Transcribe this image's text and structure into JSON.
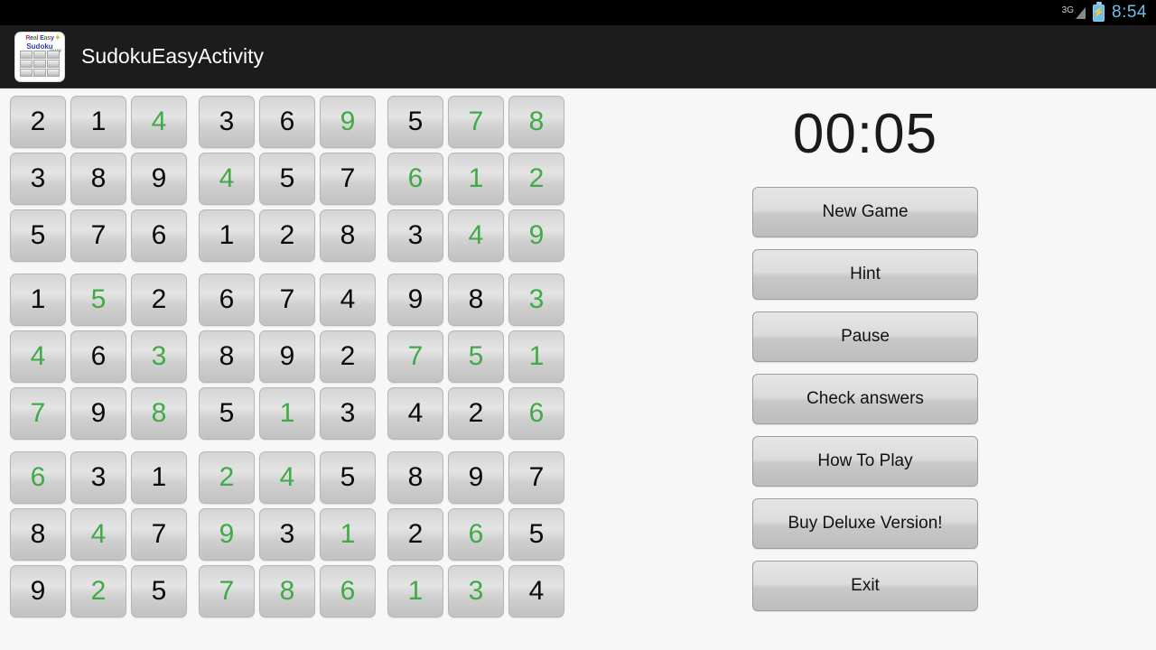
{
  "status_bar": {
    "network_label": "3G",
    "battery_icon": "battery-charging-icon",
    "signal_icon": "signal-triangle-icon",
    "time": "8:54",
    "accent_color": "#6fc0e8"
  },
  "action_bar": {
    "app_icon": "sudoku-app-icon",
    "icon_text_top": "Real Easy",
    "icon_text_mid": "Sudoku",
    "icon_text_www": "www",
    "title": "SudokuEasyActivity"
  },
  "board": {
    "name": "sudoku-grid",
    "green_color": "#3faa46",
    "fixed_color": "#0a0a0a",
    "rows": [
      [
        {
          "v": "2",
          "g": false
        },
        {
          "v": "1",
          "g": false
        },
        {
          "v": "4",
          "g": true
        },
        {
          "v": "3",
          "g": false
        },
        {
          "v": "6",
          "g": false
        },
        {
          "v": "9",
          "g": true
        },
        {
          "v": "5",
          "g": false
        },
        {
          "v": "7",
          "g": true
        },
        {
          "v": "8",
          "g": true
        }
      ],
      [
        {
          "v": "3",
          "g": false
        },
        {
          "v": "8",
          "g": false
        },
        {
          "v": "9",
          "g": false
        },
        {
          "v": "4",
          "g": true
        },
        {
          "v": "5",
          "g": false
        },
        {
          "v": "7",
          "g": false
        },
        {
          "v": "6",
          "g": true
        },
        {
          "v": "1",
          "g": true
        },
        {
          "v": "2",
          "g": true
        }
      ],
      [
        {
          "v": "5",
          "g": false
        },
        {
          "v": "7",
          "g": false
        },
        {
          "v": "6",
          "g": false
        },
        {
          "v": "1",
          "g": false
        },
        {
          "v": "2",
          "g": false
        },
        {
          "v": "8",
          "g": false
        },
        {
          "v": "3",
          "g": false
        },
        {
          "v": "4",
          "g": true
        },
        {
          "v": "9",
          "g": true
        }
      ],
      [
        {
          "v": "1",
          "g": false
        },
        {
          "v": "5",
          "g": true
        },
        {
          "v": "2",
          "g": false
        },
        {
          "v": "6",
          "g": false
        },
        {
          "v": "7",
          "g": false
        },
        {
          "v": "4",
          "g": false
        },
        {
          "v": "9",
          "g": false
        },
        {
          "v": "8",
          "g": false
        },
        {
          "v": "3",
          "g": true
        }
      ],
      [
        {
          "v": "4",
          "g": true
        },
        {
          "v": "6",
          "g": false
        },
        {
          "v": "3",
          "g": true
        },
        {
          "v": "8",
          "g": false
        },
        {
          "v": "9",
          "g": false
        },
        {
          "v": "2",
          "g": false
        },
        {
          "v": "7",
          "g": true
        },
        {
          "v": "5",
          "g": true
        },
        {
          "v": "1",
          "g": true
        }
      ],
      [
        {
          "v": "7",
          "g": true
        },
        {
          "v": "9",
          "g": false
        },
        {
          "v": "8",
          "g": true
        },
        {
          "v": "5",
          "g": false
        },
        {
          "v": "1",
          "g": true
        },
        {
          "v": "3",
          "g": false
        },
        {
          "v": "4",
          "g": false
        },
        {
          "v": "2",
          "g": false
        },
        {
          "v": "6",
          "g": true
        }
      ],
      [
        {
          "v": "6",
          "g": true
        },
        {
          "v": "3",
          "g": false
        },
        {
          "v": "1",
          "g": false
        },
        {
          "v": "2",
          "g": true
        },
        {
          "v": "4",
          "g": true
        },
        {
          "v": "5",
          "g": false
        },
        {
          "v": "8",
          "g": false
        },
        {
          "v": "9",
          "g": false
        },
        {
          "v": "7",
          "g": false
        }
      ],
      [
        {
          "v": "8",
          "g": false
        },
        {
          "v": "4",
          "g": true
        },
        {
          "v": "7",
          "g": false
        },
        {
          "v": "9",
          "g": true
        },
        {
          "v": "3",
          "g": false
        },
        {
          "v": "1",
          "g": true
        },
        {
          "v": "2",
          "g": false
        },
        {
          "v": "6",
          "g": true
        },
        {
          "v": "5",
          "g": false
        }
      ],
      [
        {
          "v": "9",
          "g": false
        },
        {
          "v": "2",
          "g": true
        },
        {
          "v": "5",
          "g": false
        },
        {
          "v": "7",
          "g": true
        },
        {
          "v": "8",
          "g": true
        },
        {
          "v": "6",
          "g": true
        },
        {
          "v": "1",
          "g": true
        },
        {
          "v": "3",
          "g": true
        },
        {
          "v": "4",
          "g": false
        }
      ]
    ]
  },
  "panel": {
    "timer": "00:05",
    "buttons": [
      {
        "label": "New Game",
        "name": "new-game-button"
      },
      {
        "label": "Hint",
        "name": "hint-button"
      },
      {
        "label": "Pause",
        "name": "pause-button"
      },
      {
        "label": "Check answers",
        "name": "check-answers-button"
      },
      {
        "label": "How To Play",
        "name": "how-to-play-button"
      },
      {
        "label": "Buy Deluxe Version!",
        "name": "buy-deluxe-version-button"
      },
      {
        "label": "Exit",
        "name": "exit-button"
      }
    ]
  }
}
